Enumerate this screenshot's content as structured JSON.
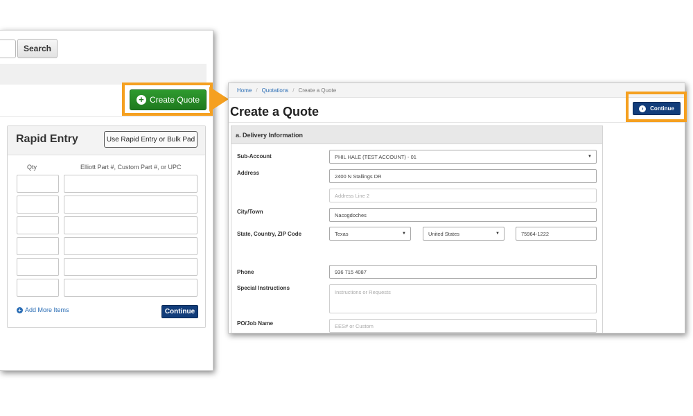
{
  "left_panel": {
    "search_button": "Search",
    "create_quote_button": "Create Quote",
    "rapid_entry": {
      "title": "Rapid Entry",
      "bulk_button": "Use Rapid Entry or Bulk Pad",
      "col_qty": "Qty",
      "col_part": "Elliott Part #, Custom Part #, or UPC",
      "add_more": "Add More Items",
      "continue_button": "Continue"
    }
  },
  "right_panel": {
    "breadcrumb": {
      "home": "Home",
      "quotations": "Quotations",
      "current": "Create a Quote",
      "separator": "/"
    },
    "title": "Create a Quote",
    "continue_button": "Continue",
    "section_title": "a. Delivery Information",
    "labels": {
      "sub_account": "Sub-Account",
      "address": "Address",
      "city": "City/Town",
      "state_country_zip": "State, Country, ZIP Code",
      "phone": "Phone",
      "special_instructions": "Special Instructions",
      "po_job": "PO/Job Name"
    },
    "values": {
      "sub_account": "PHIL HALE (TEST ACCOUNT) - 01",
      "address1": "2400 N Stallings DR",
      "city": "Nacogdoches",
      "state": "Texas",
      "country": "United States",
      "zip": "75964-1222",
      "phone": "936 715 4087"
    },
    "placeholders": {
      "address2": "Address Line 2",
      "instructions": "Instructions or Requests",
      "po_job": "EES# or Custom"
    }
  },
  "colors": {
    "highlight": "#f5a020",
    "create_quote_green": "#2e9a2e",
    "continue_navy": "#123d7a",
    "link_blue": "#2a6db5"
  }
}
